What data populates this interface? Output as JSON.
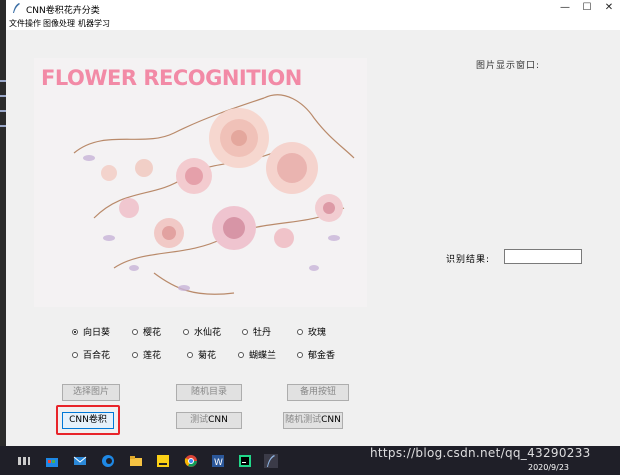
{
  "window": {
    "title": "CNN卷积花卉分类",
    "controls": [
      "—",
      "☐",
      "✕"
    ]
  },
  "menu": [
    "文件操作",
    "图像处理",
    "机器学习"
  ],
  "image": {
    "heading": "FLOWER RECOGNITION"
  },
  "display": {
    "label": "图片显示窗口:"
  },
  "result": {
    "label": "识别结果:",
    "value": ""
  },
  "flowers": {
    "row1": [
      "向日葵",
      "樱花",
      "水仙花",
      "牡丹",
      "玫瑰"
    ],
    "row2": [
      "百合花",
      "莲花",
      "菊花",
      "蝴蝶兰",
      "郁金香"
    ],
    "selected": "向日葵"
  },
  "buttons": {
    "select_image": "选择图片",
    "random_dir": "随机目录",
    "spare": "备用按钮",
    "cnn_conv": "CNN卷积",
    "test_cnn_prefix": "测试",
    "test_cnn_en": "CNN",
    "random_test_prefix": "随机测试",
    "random_test_en": "CNN"
  },
  "taskbar": {
    "date": "2020/9/23",
    "watermark": "https://blog.csdn.net/qq_43290233"
  },
  "colors": {
    "accent_red": "#e8242a",
    "heading_pink": "#f28aa6",
    "taskbar": "#1f1f28"
  }
}
